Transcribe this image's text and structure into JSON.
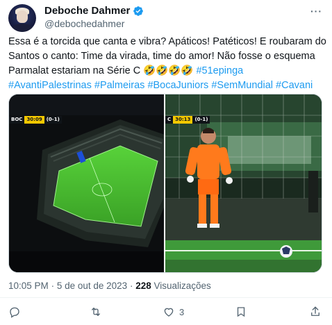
{
  "author": {
    "display_name": "Deboche Dahmer",
    "handle": "@debochedahmer"
  },
  "tweet": {
    "text_plain": "Essa é a torcida que canta e vibra? Apáticos! Patéticos! E roubaram do Santos o canto: Time da virada, time do amor! Não fosse o esquema Parmalat estariam na Série C ",
    "emoji": "🤣🤣🤣🤣",
    "hashtags": [
      "#51epinga",
      "#AvantiPalestrinas",
      "#Palmeiras",
      "#BocaJuniors",
      "#SemMundial",
      "#Cavani"
    ]
  },
  "media": {
    "left": {
      "team": "BOC",
      "time": "30:09",
      "score": "(0-1)"
    },
    "right": {
      "team": "C",
      "time": "30:13",
      "score": "(0-1)"
    }
  },
  "meta": {
    "time": "10:05 PM",
    "dot1": "·",
    "date": "5 de out de 2023",
    "dot2": "·",
    "views_count": "228",
    "views_label": "Visualizações"
  },
  "actions": {
    "reply_icon": "reply-icon",
    "retweet_icon": "retweet-icon",
    "like_icon": "heart-icon",
    "like_count": "3",
    "bookmark_icon": "bookmark-icon",
    "share_icon": "share-icon"
  },
  "colors": {
    "link": "#1d9bf0",
    "secondary": "#536471",
    "verified": "#1d9bf0"
  }
}
